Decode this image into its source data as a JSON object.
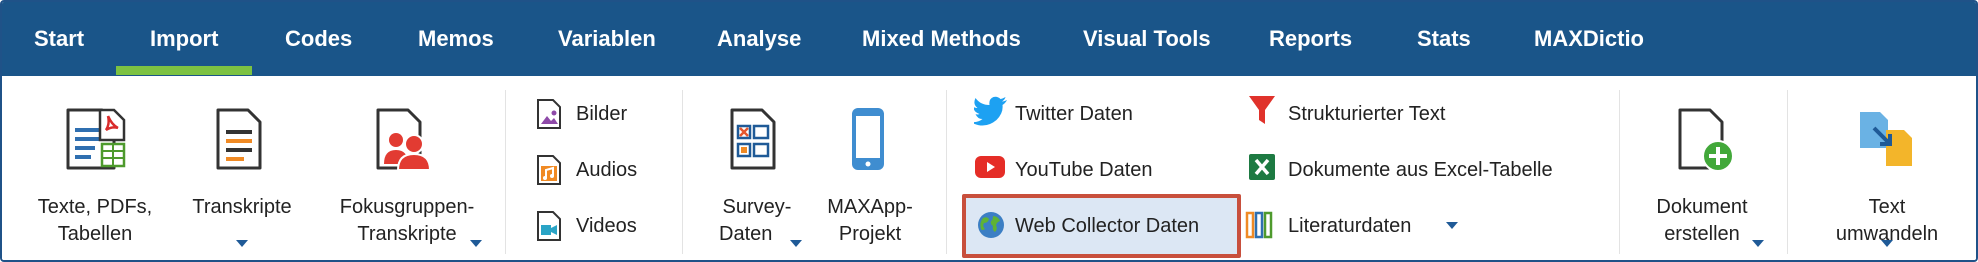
{
  "menu": {
    "tabs": [
      {
        "label": "Start"
      },
      {
        "label": "Import"
      },
      {
        "label": "Codes"
      },
      {
        "label": "Memos"
      },
      {
        "label": "Variablen"
      },
      {
        "label": "Analyse"
      },
      {
        "label": "Mixed Methods"
      },
      {
        "label": "Visual Tools"
      },
      {
        "label": "Reports"
      },
      {
        "label": "Stats"
      },
      {
        "label": "MAXDictio"
      }
    ],
    "active_tab": "Import"
  },
  "ribbon": {
    "texts_pdfs": {
      "line1": "Texte, PDFs,",
      "line2": "Tabellen"
    },
    "transcripts": {
      "line1": "Transkripte"
    },
    "focus_groups": {
      "line1": "Fokusgruppen-",
      "line2": "Transkripte"
    },
    "images": "Bilder",
    "audios": "Audios",
    "videos": "Videos",
    "survey": {
      "line1": "Survey-",
      "line2": "Daten"
    },
    "maxapp": {
      "line1": "MAXApp-",
      "line2": "Projekt"
    },
    "twitter": "Twitter Daten",
    "youtube": "YouTube Daten",
    "web_collector": "Web Collector Daten",
    "structured_text": "Strukturierter Text",
    "excel_docs": "Dokumente aus Excel-Tabelle",
    "literature": "Literaturdaten",
    "create_doc": {
      "line1": "Dokument",
      "line2": "erstellen"
    },
    "convert_text": {
      "line1": "Text",
      "line2": "umwandeln"
    }
  },
  "colors": {
    "menubar": "#1a5589",
    "active_underline": "#7cc242",
    "highlight_border": "#c84f3c",
    "highlight_fill": "#dce7f4"
  }
}
